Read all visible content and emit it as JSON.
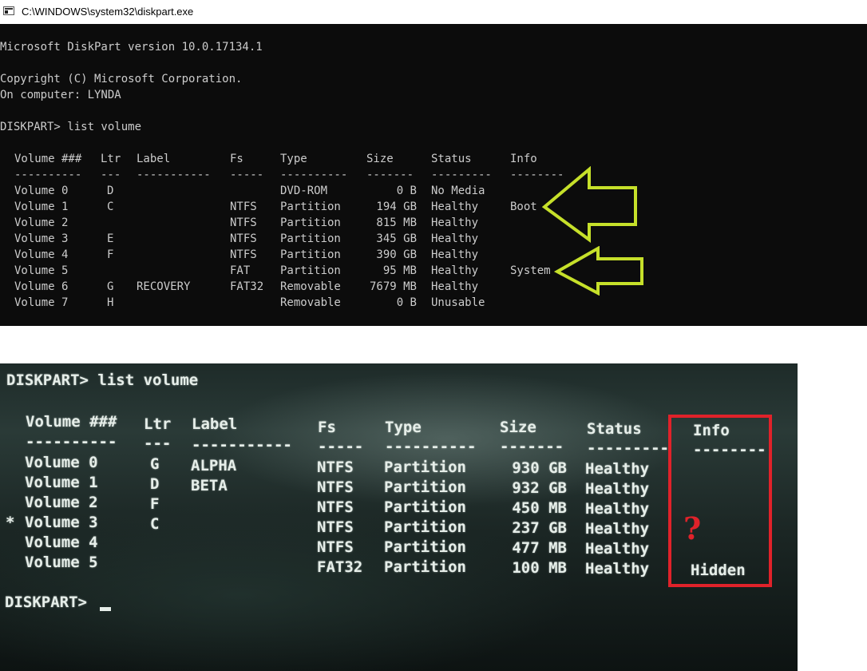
{
  "window": {
    "title": "C:\\WINDOWS\\system32\\diskpart.exe",
    "icon": "console-app-icon"
  },
  "console": {
    "banner": "Microsoft DiskPart version 10.0.17134.1",
    "copyright": "Copyright (C) Microsoft Corporation.",
    "computer": "On computer: LYNDA",
    "command": "DISKPART> list volume",
    "headers": [
      "Volume ###",
      "Ltr",
      "Label",
      "Fs",
      "Type",
      "Size",
      "Status",
      "Info"
    ],
    "separators": [
      "----------",
      "---",
      "-----------",
      "-----",
      "----------",
      "-------",
      "---------",
      "--------"
    ],
    "rows": [
      {
        "volume": "Volume 0",
        "ltr": "D",
        "label": "",
        "fs": "",
        "type": "DVD-ROM",
        "size": "0 B",
        "status": "No Media",
        "info": ""
      },
      {
        "volume": "Volume 1",
        "ltr": "C",
        "label": "",
        "fs": "NTFS",
        "type": "Partition",
        "size": "194 GB",
        "status": "Healthy",
        "info": "Boot"
      },
      {
        "volume": "Volume 2",
        "ltr": "",
        "label": "",
        "fs": "NTFS",
        "type": "Partition",
        "size": "815 MB",
        "status": "Healthy",
        "info": ""
      },
      {
        "volume": "Volume 3",
        "ltr": "E",
        "label": "",
        "fs": "NTFS",
        "type": "Partition",
        "size": "345 GB",
        "status": "Healthy",
        "info": ""
      },
      {
        "volume": "Volume 4",
        "ltr": "F",
        "label": "",
        "fs": "NTFS",
        "type": "Partition",
        "size": "390 GB",
        "status": "Healthy",
        "info": ""
      },
      {
        "volume": "Volume 5",
        "ltr": "",
        "label": "",
        "fs": "FAT",
        "type": "Partition",
        "size": "95 MB",
        "status": "Healthy",
        "info": "System"
      },
      {
        "volume": "Volume 6",
        "ltr": "G",
        "label": "RECOVERY",
        "fs": "FAT32",
        "type": "Removable",
        "size": "7679 MB",
        "status": "Healthy",
        "info": ""
      },
      {
        "volume": "Volume 7",
        "ltr": "H",
        "label": "",
        "fs": "",
        "type": "Removable",
        "size": "0 B",
        "status": "Unusable",
        "info": ""
      }
    ],
    "arrow_color": "#c6e02a"
  },
  "photo": {
    "command": "DISKPART> list volume",
    "headers": [
      "Volume ###",
      "Ltr",
      "Label",
      "Fs",
      "Type",
      "Size",
      "Status",
      "Info"
    ],
    "separators": [
      "----------",
      "---",
      "-----------",
      "-----",
      "----------",
      "-------",
      "---------",
      "--------"
    ],
    "rows": [
      {
        "marker": "",
        "volume": "Volume 0",
        "ltr": "G",
        "label": "ALPHA",
        "fs": "NTFS",
        "type": "Partition",
        "size": "930 GB",
        "status": "Healthy",
        "info": ""
      },
      {
        "marker": "",
        "volume": "Volume 1",
        "ltr": "D",
        "label": "BETA",
        "fs": "NTFS",
        "type": "Partition",
        "size": "932 GB",
        "status": "Healthy",
        "info": ""
      },
      {
        "marker": "",
        "volume": "Volume 2",
        "ltr": "F",
        "label": "",
        "fs": "NTFS",
        "type": "Partition",
        "size": "450 MB",
        "status": "Healthy",
        "info": ""
      },
      {
        "marker": "*",
        "volume": "Volume 3",
        "ltr": "C",
        "label": "",
        "fs": "NTFS",
        "type": "Partition",
        "size": "237 GB",
        "status": "Healthy",
        "info": ""
      },
      {
        "marker": "",
        "volume": "Volume 4",
        "ltr": "",
        "label": "",
        "fs": "NTFS",
        "type": "Partition",
        "size": "477 MB",
        "status": "Healthy",
        "info": ""
      },
      {
        "marker": "",
        "volume": "Volume 5",
        "ltr": "",
        "label": "",
        "fs": "FAT32",
        "type": "Partition",
        "size": "100 MB",
        "status": "Healthy",
        "info": "Hidden"
      }
    ],
    "prompt": "DISKPART>",
    "question_mark": "?",
    "highlight_color": "#e0222a"
  }
}
